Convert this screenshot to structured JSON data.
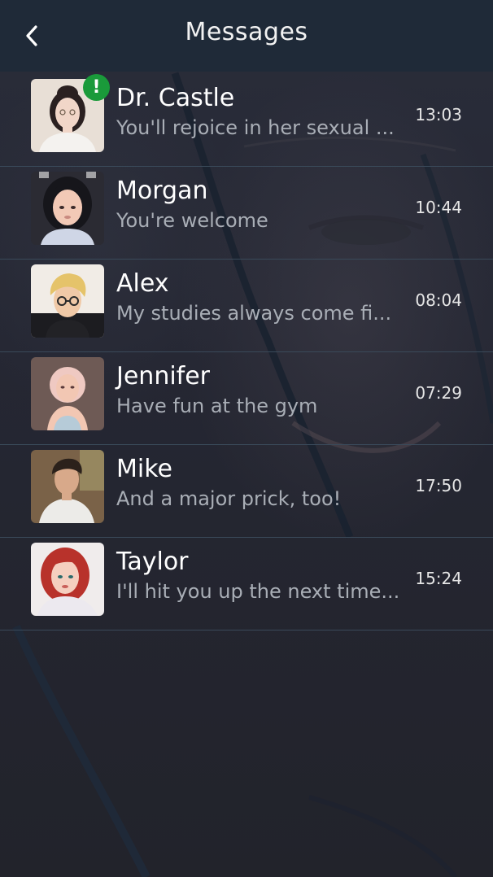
{
  "header": {
    "title": "Messages",
    "back_icon": "chevron-left-icon"
  },
  "conversations": [
    {
      "name": "Dr. Castle",
      "preview": "You'll rejoice in her sexual ...",
      "time": "13:03",
      "unread": true,
      "badge": "!",
      "avatar_colors": {
        "bg": "#e8dfd6",
        "hair": "#2a2020",
        "skin": "#f1d6c8",
        "top": "#f4f2ef"
      }
    },
    {
      "name": "Morgan",
      "preview": "You're welcome",
      "time": "10:44",
      "unread": false,
      "avatar_colors": {
        "bg": "#2b2b33",
        "hair": "#16161b",
        "skin": "#f2c9b6",
        "top": "#cfd6e6"
      }
    },
    {
      "name": "Alex",
      "preview": "My studies always come fi...",
      "time": "08:04",
      "unread": false,
      "avatar_colors": {
        "bg": "#f1ece6",
        "hair": "#e5c36a",
        "skin": "#f0c9a7",
        "top": "#222226"
      }
    },
    {
      "name": "Jennifer",
      "preview": "Have fun at the gym",
      "time": "07:29",
      "unread": false,
      "avatar_colors": {
        "bg": "#6e5a55",
        "hair": "#efc9c2",
        "skin": "#f2c7b3",
        "top": "#b6cbd8"
      }
    },
    {
      "name": "Mike",
      "preview": "And a major prick, too!",
      "time": "17:50",
      "unread": false,
      "avatar_colors": {
        "bg": "#7a6248",
        "hair": "#2b211b",
        "skin": "#d8a98a",
        "top": "#ecebe8"
      }
    },
    {
      "name": "Taylor",
      "preview": "I'll hit you up the next time...",
      "time": "15:24",
      "unread": false,
      "avatar_colors": {
        "bg": "#f0ecec",
        "hair": "#b8322b",
        "skin": "#f5cfbf",
        "top": "#ece9ef"
      }
    }
  ]
}
